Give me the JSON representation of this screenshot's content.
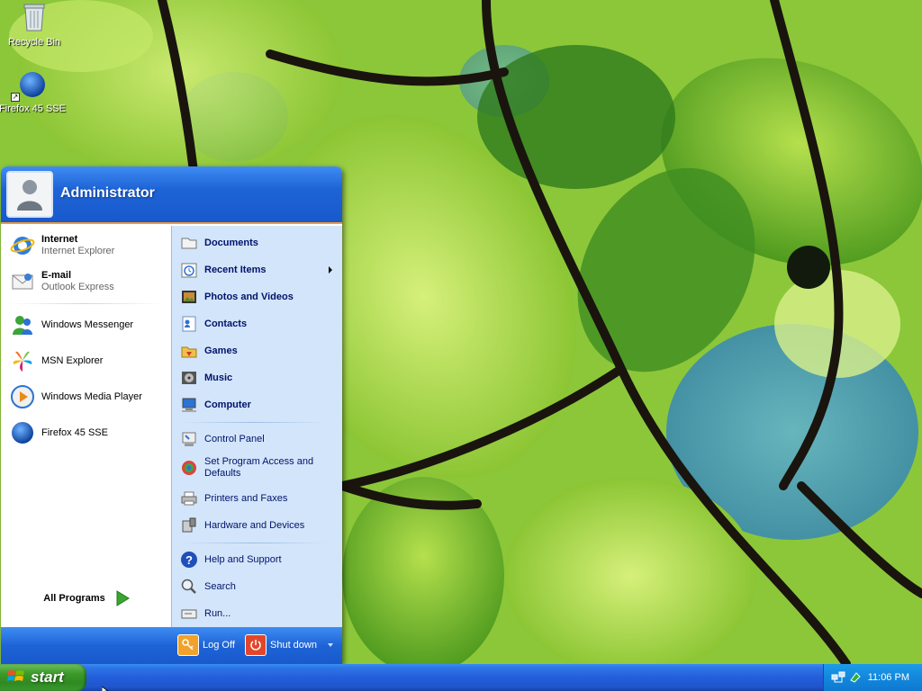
{
  "desktop": {
    "icons": [
      {
        "label": "Recycle Bin",
        "icon": "recycle-bin-icon"
      },
      {
        "label": "Firefox 45 SSE",
        "icon": "firefox-icon"
      }
    ]
  },
  "start_menu": {
    "user_name": "Administrator",
    "pinned": [
      {
        "title": "Internet",
        "subtitle": "Internet Explorer",
        "icon": "internet-explorer-icon"
      },
      {
        "title": "E-mail",
        "subtitle": "Outlook Express",
        "icon": "outlook-express-icon"
      }
    ],
    "recent": [
      {
        "label": "Windows Messenger",
        "icon": "windows-messenger-icon"
      },
      {
        "label": "MSN Explorer",
        "icon": "msn-explorer-icon"
      },
      {
        "label": "Windows Media Player",
        "icon": "media-player-icon"
      },
      {
        "label": "Firefox 45 SSE",
        "icon": "firefox-icon"
      }
    ],
    "all_programs_label": "All Programs",
    "places": [
      {
        "label": "Documents",
        "icon": "documents-icon"
      },
      {
        "label": "Recent Items",
        "icon": "recent-items-icon"
      },
      {
        "label": "Photos and Videos",
        "icon": "photos-icon"
      },
      {
        "label": "Contacts",
        "icon": "contacts-icon"
      },
      {
        "label": "Games",
        "icon": "games-icon"
      },
      {
        "label": "Music",
        "icon": "music-icon"
      },
      {
        "label": "Computer",
        "icon": "computer-icon"
      }
    ],
    "system": [
      {
        "label": "Control Panel",
        "icon": "control-panel-icon"
      },
      {
        "label": "Set Program Access and Defaults",
        "icon": "program-access-icon"
      },
      {
        "label": "Printers and Faxes",
        "icon": "printer-icon"
      },
      {
        "label": "Hardware and Devices",
        "icon": "hardware-icon"
      }
    ],
    "help": [
      {
        "label": "Help and Support",
        "icon": "help-icon"
      },
      {
        "label": "Search",
        "icon": "search-icon"
      },
      {
        "label": "Run...",
        "icon": "run-icon"
      }
    ],
    "log_off_label": "Log Off",
    "shut_down_label": "Shut down"
  },
  "taskbar": {
    "start_label": "start",
    "clock": "11:06 PM"
  },
  "colors": {
    "start_header": "#1e64d7",
    "start_button": "#3c9a2a",
    "taskbar": "#245edb",
    "tray": "#1288dd",
    "places_panel": "#d3e5fa"
  }
}
